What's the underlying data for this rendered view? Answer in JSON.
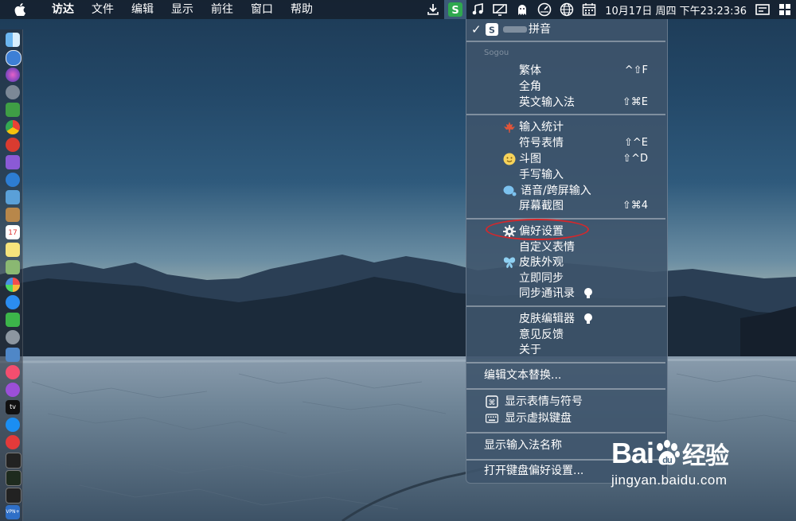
{
  "menubar": {
    "app_name": "访达",
    "items": [
      "文件",
      "编辑",
      "显示",
      "前往",
      "窗口",
      "帮助"
    ],
    "clock": "10月17日 周四 下午23:23:36",
    "status_icons": [
      "download-icon",
      "sogou-ime-icon",
      "music-note-icon",
      "display-icon",
      "ghost-icon",
      "speedometer-icon",
      "globe-icon",
      "calendar-icon",
      "screen-icon",
      "grid-icon"
    ]
  },
  "dock": {
    "icons": [
      "finder-icon",
      "safari-icon",
      "siri-icon",
      "launchpad-icon",
      "android-icon",
      "chrome-icon",
      "app-red-icon",
      "app-purple-icon",
      "xcode-icon",
      "preview-icon",
      "notes-icon",
      "calendar-icon",
      "stickies-icon",
      "photos-preview-icon",
      "photos-icon",
      "messages-icon",
      "facetime-icon",
      "system-prefs-icon",
      "keynote-icon",
      "music-icon",
      "podcasts-icon",
      "appletv-icon",
      "appstore-icon",
      "vivaldi-icon",
      "terminal-icon",
      "activity-monitor-icon",
      "terminal2-icon",
      "vpn-icon"
    ],
    "calendar_day": "17",
    "appletv_label": "tv",
    "vpn_label": "VPN+"
  },
  "ime_menu": {
    "current_input": "拼音",
    "section_label": "Sogou",
    "items": {
      "traditional": {
        "label": "繁体",
        "shortcut": "^⇧F"
      },
      "fullwidth": {
        "label": "全角"
      },
      "english_mode": {
        "label": "英文输入法",
        "shortcut": "⇧⌘E"
      },
      "input_stats": {
        "label": "输入统计"
      },
      "symbols_emoji": {
        "label": "符号表情",
        "shortcut": "⇧^E"
      },
      "doutu": {
        "label": "斗图",
        "shortcut": "⇧^D"
      },
      "handwriting": {
        "label": "手写输入"
      },
      "voice_input": {
        "label": "语音/跨屏输入"
      },
      "screenshot": {
        "label": "屏幕截图",
        "shortcut": "⇧⌘4"
      },
      "preferences": {
        "label": "偏好设置"
      },
      "custom_emoji": {
        "label": "自定义表情"
      },
      "skin": {
        "label": "皮肤外观"
      },
      "sync_now": {
        "label": "立即同步"
      },
      "sync_contacts": {
        "label": "同步通讯录"
      },
      "skin_editor": {
        "label": "皮肤编辑器"
      },
      "feedback": {
        "label": "意见反馈"
      },
      "about": {
        "label": "关于"
      },
      "text_replace": {
        "label": "编辑文本替换..."
      },
      "show_emoji_symbols": {
        "label": "显示表情与符号"
      },
      "show_virtual_keyboard": {
        "label": "显示虚拟键盘"
      },
      "show_ime_name": {
        "label": "显示输入法名称"
      },
      "open_keyboard_prefs": {
        "label": "打开键盘偏好设置..."
      }
    }
  },
  "watermark": {
    "logo_prefix": "Bai",
    "logo_suffix": "经验",
    "url": "jingyan.baidu.com"
  },
  "colors": {
    "highlight_ring": "#d3282c",
    "sogou_green": "#2fa84f"
  }
}
